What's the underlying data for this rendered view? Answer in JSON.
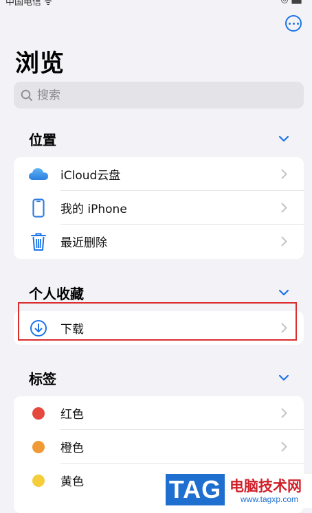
{
  "status_bar": {
    "carrier": "中国电信 ᯤ",
    "right": "◎ ⬛"
  },
  "header": {
    "title": "浏览",
    "more_icon": "ellipsis-circle-icon"
  },
  "search": {
    "placeholder": "搜索"
  },
  "sections": {
    "locations": {
      "title": "位置",
      "items": [
        {
          "label": "iCloud云盘",
          "icon": "icloud-icon"
        },
        {
          "label": "我的 iPhone",
          "icon": "iphone-icon"
        },
        {
          "label": "最近删除",
          "icon": "trash-icon"
        }
      ]
    },
    "favorites": {
      "title": "个人收藏",
      "items": [
        {
          "label": "下载",
          "icon": "download-circle-icon"
        }
      ]
    },
    "tags": {
      "title": "标签",
      "items": [
        {
          "label": "红色",
          "color": "#e5483d"
        },
        {
          "label": "橙色",
          "color": "#ef9a36"
        },
        {
          "label": "黄色",
          "color": "#f5cd3a"
        }
      ]
    }
  },
  "colors": {
    "accent": "#1a73e8",
    "highlight": "#d92c2c"
  },
  "watermark": {
    "tag": "TAG",
    "site_name": "电脑技术网",
    "url": "www.tagxp.com"
  }
}
